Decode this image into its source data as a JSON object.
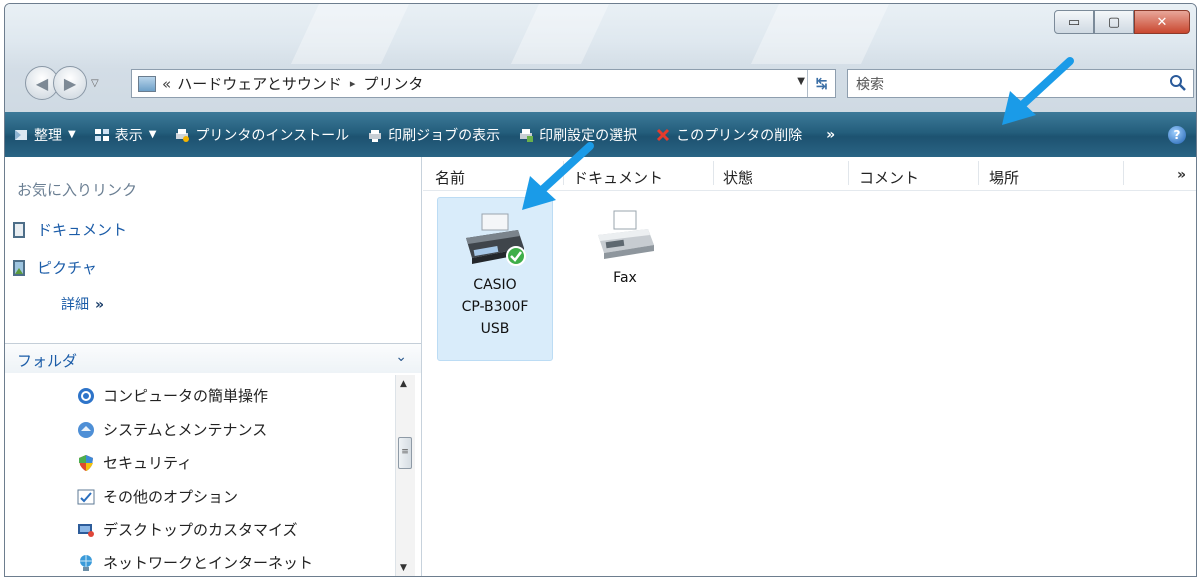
{
  "window": {
    "buttons": {
      "minimize": "▭",
      "maximize": "▢",
      "close": "✕"
    }
  },
  "address": {
    "overflow": "«",
    "path": [
      "ハードウェアとサウンド",
      "プリンタ"
    ],
    "separator": "▸"
  },
  "search": {
    "placeholder": "検索"
  },
  "toolbar": {
    "items": [
      {
        "label": "整理",
        "caret": "▼",
        "icon": "organize-icon"
      },
      {
        "label": "表示",
        "caret": "▼",
        "icon": "views-icon"
      },
      {
        "label": "プリンタのインストール",
        "icon": "add-printer-icon"
      },
      {
        "label": "印刷ジョブの表示",
        "icon": "print-queue-icon"
      },
      {
        "label": "印刷設定の選択",
        "icon": "print-prefs-icon"
      },
      {
        "label": "このプリンタの削除",
        "icon": "delete-icon"
      }
    ],
    "more": "»",
    "help": "?"
  },
  "favorites": {
    "title": "お気に入りリンク",
    "items": [
      {
        "label": "ドキュメント",
        "icon": "documents-icon"
      },
      {
        "label": "ピクチャ",
        "icon": "pictures-icon"
      }
    ],
    "more_label": "詳細",
    "more_chev": "»"
  },
  "folders": {
    "title": "フォルダ",
    "chev": "⌄",
    "items": [
      {
        "label": "コンピュータの簡単操作",
        "icon": "ease-of-access-icon"
      },
      {
        "label": "システムとメンテナンス",
        "icon": "system-maintenance-icon"
      },
      {
        "label": "セキュリティ",
        "icon": "security-icon"
      },
      {
        "label": "その他のオプション",
        "icon": "other-options-icon"
      },
      {
        "label": "デスクトップのカスタマイズ",
        "icon": "desktop-customize-icon"
      },
      {
        "label": "ネットワークとインターネット",
        "icon": "network-internet-icon"
      }
    ]
  },
  "columns": [
    "名前",
    "ドキュメント",
    "状態",
    "コメント",
    "場所"
  ],
  "columns_more": "»",
  "printers": [
    {
      "lines": [
        "CASIO",
        "CP-B300F",
        "USB"
      ],
      "default": true,
      "selected": true,
      "icon": "printer-default-icon"
    },
    {
      "lines": [
        "Fax"
      ],
      "default": false,
      "selected": false,
      "icon": "fax-icon"
    }
  ],
  "colors": {
    "toolbar": "#245e7c",
    "link": "#1b5ca8",
    "arrow": "#1a9be8",
    "selection": "#d9ecfa"
  }
}
